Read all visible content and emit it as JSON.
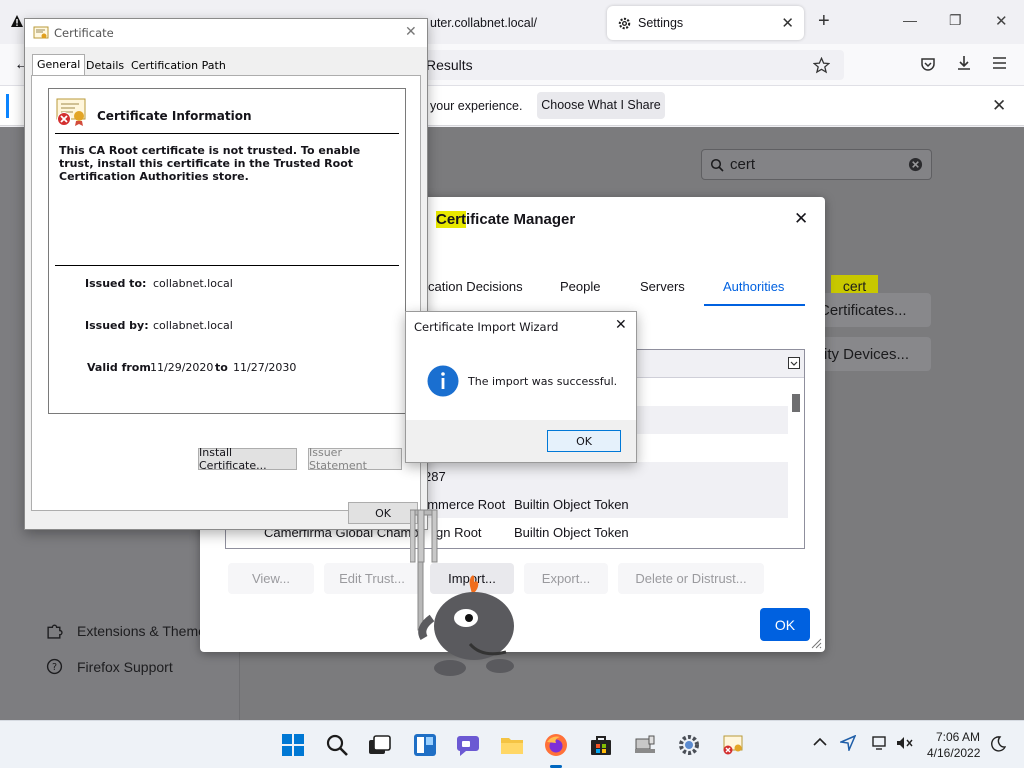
{
  "browser": {
    "tabs": [
      {
        "label": "uter.collabnet.local/",
        "close": "✕"
      },
      {
        "label": "Settings",
        "close": "✕"
      }
    ],
    "new_tab": "+",
    "url_text": "Results",
    "notification": {
      "message": "your experience.",
      "button": "Choose What I Share"
    }
  },
  "settings": {
    "search_value": "cert",
    "tooltip": "cert",
    "view_certs_button": "Certificates...",
    "security_devices_button": "rity Devices...",
    "sidebar": [
      {
        "label": "Extensions & Themes",
        "icon": "puzzle-icon"
      },
      {
        "label": "Firefox Support",
        "icon": "help-icon"
      }
    ]
  },
  "cert_manager": {
    "title_hl": "Cert",
    "title_rest": "ificate Manager",
    "tabs": [
      "cation Decisions",
      "People",
      "Servers",
      "Authorities"
    ],
    "active_tab": "Authorities",
    "rows": [
      {
        "name": "287",
        "token": ""
      },
      {
        "name": "ommerce Root",
        "token": "Builtin Object Token"
      },
      {
        "name": "Camerfirma Global Chamb",
        "name2": "gn Root",
        "token": "Builtin Object Token"
      }
    ],
    "buttons": {
      "view": "View...",
      "edit": "Edit Trust...",
      "import": "Import...",
      "export": "Export...",
      "delete": "Delete or Distrust..."
    },
    "ok": "OK"
  },
  "certificate": {
    "window_title": "Certificate",
    "tabs": [
      "General",
      "Details",
      "Certification Path"
    ],
    "heading": "Certificate Information",
    "warning": "This CA Root certificate is not trusted. To enable trust, install this certificate in the Trusted Root Certification Authorities store.",
    "issued_to_label": "Issued to:",
    "issued_to": "collabnet.local",
    "issued_by_label": "Issued by:",
    "issued_by": "collabnet.local",
    "valid_from_label": "Valid from",
    "valid_from": "11/29/2020",
    "to_label": "to",
    "valid_to": "11/27/2030",
    "install_button": "Install Certificate...",
    "issuer_button": "Issuer Statement",
    "ok": "OK"
  },
  "wizard": {
    "title": "Certificate Import Wizard",
    "message": "The import was successful.",
    "ok": "OK"
  },
  "taskbar": {
    "time": "7:06 AM",
    "date": "4/16/2022"
  },
  "colors": {
    "accent": "#0061e0",
    "highlight": "#e8e800"
  }
}
